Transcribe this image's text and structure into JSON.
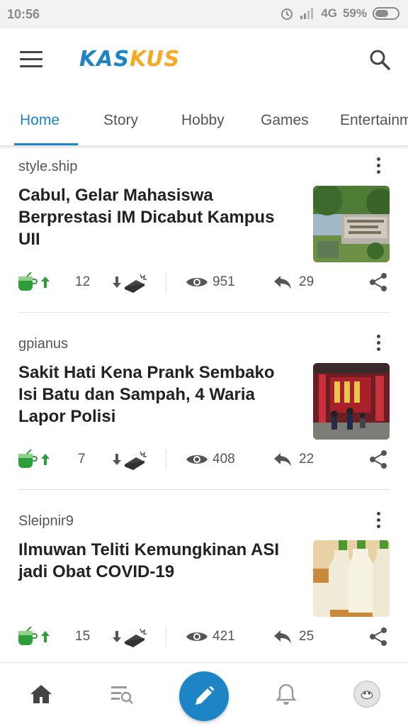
{
  "status_bar": {
    "time": "10:56",
    "network": "4G",
    "battery": "59%"
  },
  "app": {
    "logo_part1": "KAS",
    "logo_part2": "KUS",
    "brand_blue": "#1d84c6",
    "brand_orange": "#f7a824"
  },
  "tabs": [
    {
      "label": "Home",
      "active": true
    },
    {
      "label": "Story",
      "active": false
    },
    {
      "label": "Hobby",
      "active": false
    },
    {
      "label": "Games",
      "active": false
    },
    {
      "label": "Entertainm",
      "active": false
    }
  ],
  "posts": [
    {
      "author": "style.ship",
      "title": "Cabul, Gelar Mahasiswa Berprestasi IM Dicabut Kampus UII",
      "upvotes": "12",
      "views": "951",
      "replies": "29",
      "thumb_icon": "university-sign-photo"
    },
    {
      "author": "gpianus",
      "title": "Sakit Hati Kena Prank Sembako Isi Batu dan Sampah, 4 Waria Lapor Polisi",
      "upvotes": "7",
      "views": "408",
      "replies": "22",
      "thumb_icon": "police-station-photo"
    },
    {
      "author": "Sleipnir9",
      "title": "Ilmuwan Teliti Kemungkinan ASI jadi Obat COVID-19",
      "upvotes": "15",
      "views": "421",
      "replies": "25",
      "thumb_icon": "milk-bottles-photo"
    }
  ],
  "bottom_nav": [
    "home-icon",
    "search-list-icon",
    "create-thread-icon",
    "notification-bell-icon",
    "profile-avatar"
  ]
}
